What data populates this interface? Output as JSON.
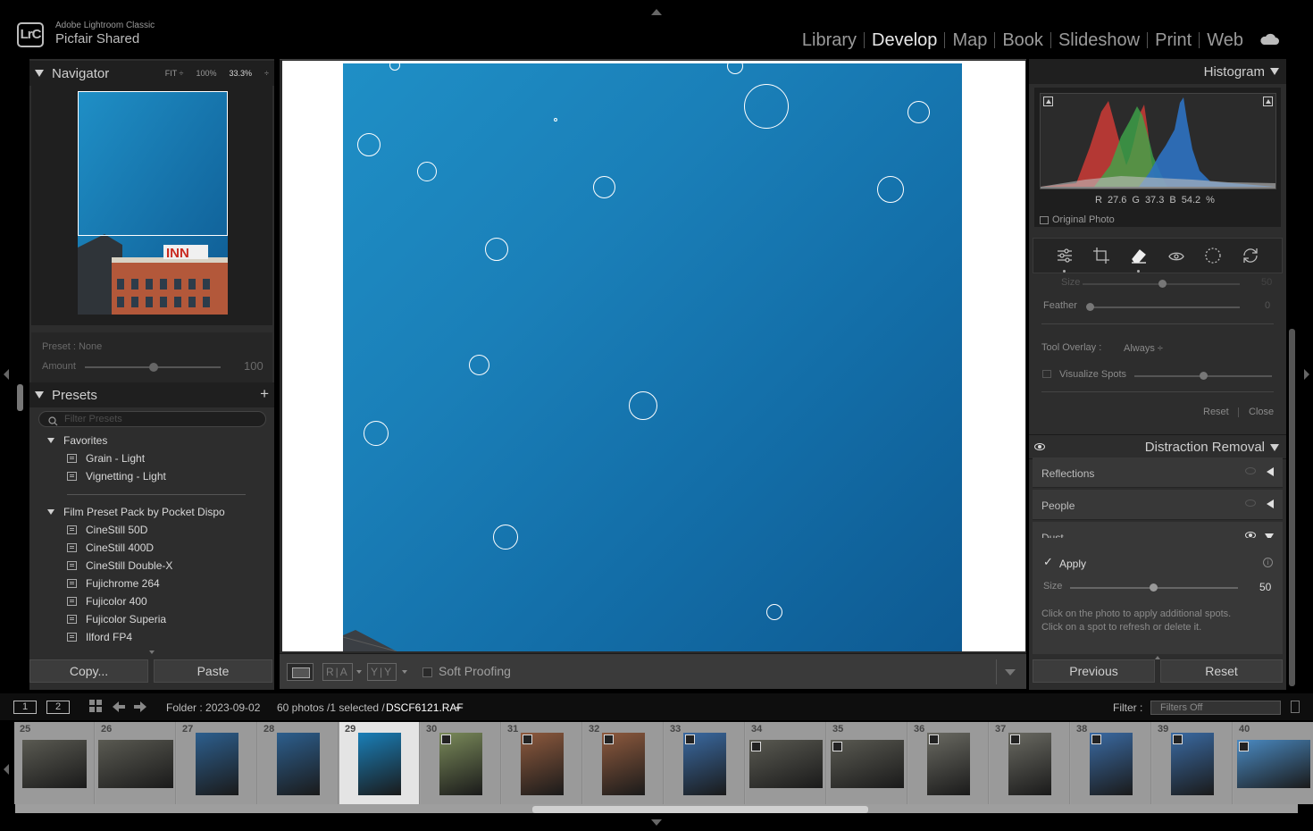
{
  "app": {
    "product": "Adobe Lightroom Classic",
    "catalog": "Picfair Shared",
    "logo": "LrC",
    "modules": [
      "Library",
      "Develop",
      "Map",
      "Book",
      "Slideshow",
      "Print",
      "Web"
    ],
    "active_module": "Develop"
  },
  "navigator": {
    "title": "Navigator",
    "zoom_fit": "FIT ÷",
    "zoom_100": "100%",
    "zoom_current": "33.3%"
  },
  "preset_amount": {
    "preset": "Preset : None",
    "amount_label": "Amount",
    "amount_value": "100",
    "amount_fraction": 0.52
  },
  "presets": {
    "title": "Presets",
    "filter_placeholder": "Filter Presets",
    "groups": [
      {
        "name": "Favorites",
        "items": [
          "Grain - Light",
          "Vignetting - Light"
        ]
      },
      {
        "name": "Film Preset Pack by Pocket Dispo",
        "items": [
          "CineStill 50D",
          "CineStill 400D",
          "CineStill Double-X",
          "Fujichrome 264",
          "Fujicolor 400",
          "Fujicolor Superia",
          "Ilford FP4"
        ]
      }
    ]
  },
  "left_buttons": {
    "copy": "Copy...",
    "paste": "Paste"
  },
  "toolbar": {
    "ra_label": "R|A",
    "yy_label": "Y|Y",
    "soft_proofing": "Soft Proofing"
  },
  "histogram": {
    "title": "Histogram",
    "r_label": "R",
    "r_value": "27.6",
    "g_label": "G",
    "g_value": "37.3",
    "b_label": "B",
    "b_value": "54.2",
    "pct": "%",
    "original_photo": "Original Photo"
  },
  "tools": [
    "sliders-icon",
    "crop-icon",
    "eraser-icon",
    "redeye-icon",
    "mask-icon",
    "rotate-icon"
  ],
  "healing": {
    "size_label": "Size",
    "size_value": "50",
    "feather_label": "Feather",
    "feather_value": "0",
    "tool_overlay_label": "Tool Overlay :",
    "tool_overlay_value": "Always ÷",
    "visualize_spots": "Visualize Spots",
    "reset": "Reset",
    "close": "Close"
  },
  "distraction_removal": {
    "title": "Distraction Removal",
    "reflections": "Reflections",
    "people": "People",
    "dust": "Dust",
    "apply": "Apply",
    "size_label": "Size",
    "size_value": "50",
    "hint1": "Click on the photo to apply additional spots.",
    "hint2": "Click on a spot to refresh or delete it."
  },
  "right_buttons": {
    "previous": "Previous",
    "reset": "Reset"
  },
  "filmstrip": {
    "screen1": "1",
    "screen2": "2",
    "folder": "Folder : 2023-09-02",
    "count": "60 photos /1 selected /",
    "filename": "DSCF6121.RAF",
    "filter_label": "Filter :",
    "filter_value": "Filters Off",
    "cells": [
      "25",
      "26",
      "27",
      "28",
      "29",
      "30",
      "31",
      "32",
      "33",
      "34",
      "35",
      "36",
      "37",
      "38",
      "39",
      "40"
    ],
    "selected": "29"
  },
  "colors": {
    "photo_top": "#1f8fc6",
    "photo_bottom": "#0e5a92",
    "panel": "#2d2d2d",
    "background": "#000000"
  }
}
